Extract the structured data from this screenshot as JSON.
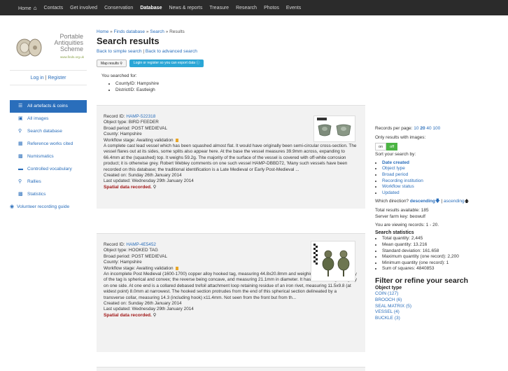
{
  "nav": {
    "items": [
      "Contacts",
      "Get involved",
      "Conservation",
      "Database",
      "News & reports",
      "Treasure",
      "Research",
      "Photos",
      "Events"
    ],
    "home_label": "Home",
    "active": "Database"
  },
  "logo": {
    "line1": "Portable",
    "line2": "Antiquities",
    "line3": "Scheme",
    "url": "www.finds.org.uk"
  },
  "login": {
    "login_label": "Log in",
    "register_label": "Register"
  },
  "sidebar": {
    "items": [
      {
        "label": "All artefacts & coins",
        "icon": "list-icon"
      },
      {
        "label": "All images",
        "icon": "image-icon"
      },
      {
        "label": "Search database",
        "icon": "search-icon"
      },
      {
        "label": "Reference works cited",
        "icon": "book-icon"
      },
      {
        "label": "Numismatics",
        "icon": "coins-icon"
      },
      {
        "label": "Controlled vocabulary",
        "icon": "folder-icon"
      },
      {
        "label": "Rallies",
        "icon": "map-marker-icon"
      },
      {
        "label": "Statistics",
        "icon": "chart-icon"
      },
      {
        "label": "Volunteer recording guide",
        "icon": "eye-icon"
      }
    ]
  },
  "breadcrumb": {
    "home": "Home",
    "finds": "Finds database",
    "search": "Search",
    "current": "Results"
  },
  "page_title": "Search results",
  "back_links": {
    "simple": "Back to simple search",
    "advanced": "Back to advanced search"
  },
  "buttons": {
    "map": "Map results",
    "export": "Login or register so you can export data"
  },
  "searched_for": {
    "label": "You searched for:",
    "criteria": [
      "CountyID: Hampshire",
      "DistrictID: Eastleigh"
    ]
  },
  "records": [
    {
      "id_label": "Record ID: ",
      "id": "HAMP-522318",
      "object_type": "Object type: BIRD FEEDER",
      "broad_period": "Broad period: POST MEDIEVAL",
      "county": "County: Hampshire",
      "workflow": "Workflow stage: Awaiting validation",
      "description": "A complete cast lead vessel which has been squashed almost flat. It would have originally been semi-circular cross-section. The vessel flares out at its sides, some splits also appear here. At the base the vessel measures 39.9mm across, expanding to 66.4mm at the (squashed) top. It weighs 59.2g. The majority of the surface of the vessel is covered with off-white corrosion product; it is otherwise grey. Robert Webley comments on one such vessel HAMP-DBBD72, 'Many such vessels have been recorded on this database; the traditional identification is a Late Medieval or Early Post-Medieval ...",
      "created": "Created on: Sunday 26th January 2014",
      "updated": "Last updated: Wednesday 29th January 2014",
      "spatial": "Spatial data recorded."
    },
    {
      "id_label": "Record ID: ",
      "id": "HAMP-4E5452",
      "object_type": "Object type: HOOKED TAG",
      "broad_period": "Broad period: POST MEDIEVAL",
      "county": "County: Hampshire",
      "workflow": "Workflow stage: Awaiting validation",
      "description": "An incomplete Post Medieval (1600-1700) copper alloy hooked tag, measuring 44.8x20.8mm and weighing 8.1g. The main body of the tag is spherical and convex; the reverse being concave, and measuring 21.1mm in diameter. It has been damaged slightly on one side. At one end is a collared debased trefoil attachment loop retaining residue of an iron rivet, measuring 11.5x9.8 (at widest point) 8.0mm at narrowest. The hooked section protrudes from the end of this spherical section delineated by a transverse collar, measuring 14.3 (including hook) x11.4mm. Not seen from the front but from th...",
      "created": "Created on: Sunday 26th January 2014",
      "updated": "Last updated: Wednesday 29th January 2014",
      "spatial": "Spatial data recorded."
    }
  ],
  "right": {
    "per_page_label": "Records per page:",
    "per_page_options": [
      "10",
      "20",
      "40",
      "100"
    ],
    "images_only_label": "Only results with images:",
    "toggle_on": "on",
    "toggle_off": "off",
    "sort_label": "Sort your search by:",
    "sort_options": [
      "Date created",
      "Object type",
      "Broad period",
      "Recording institution",
      "Workflow status",
      "Updated"
    ],
    "direction_label": "Which direction?",
    "descending": "descending",
    "ascending": "ascending",
    "total_results": "Total results available: 185",
    "server_farm": "Server farm key: beowulf",
    "viewing": "You are viewing records: 1 - 20.",
    "stats_heading": "Search statistics",
    "stats": [
      "Total quantity: 2,445",
      "Mean quantity: 13.216",
      "Standard deviation: 161.658",
      "Maximum quantity (one record): 2,200",
      "Minimum quantity (one record): 1",
      "Sum of squares: 4840853"
    ],
    "filter_heading": "Filter or refine your search",
    "object_type_heading": "Object type",
    "object_types": [
      "COIN (127)",
      "BROOCH (6)",
      "SEAL MATRIX (5)",
      "VESSEL (4)",
      "BUCKLE (3)"
    ]
  },
  "colors": {
    "nav_bg": "#2b2b2b",
    "link": "#2a6ebb",
    "active_side": "#2a6ebb",
    "export_btn": "#2aa6d6",
    "toggle_off": "#4bb443",
    "spatial": "#a01616"
  }
}
